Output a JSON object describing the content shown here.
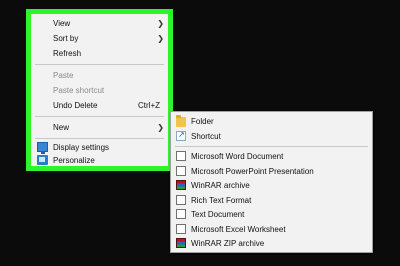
{
  "context_menu": {
    "items": [
      {
        "label": "View",
        "has_submenu": true
      },
      {
        "label": "Sort by",
        "has_submenu": true
      },
      {
        "label": "Refresh"
      },
      {
        "label": "Paste",
        "disabled": true
      },
      {
        "label": "Paste shortcut",
        "disabled": true
      },
      {
        "label": "Undo Delete",
        "shortcut": "Ctrl+Z"
      },
      {
        "label": "New",
        "has_submenu": true
      },
      {
        "label": "Display settings",
        "icon": "display-settings-icon"
      },
      {
        "label": "Personalize",
        "icon": "personalize-icon"
      }
    ]
  },
  "new_submenu": {
    "items": [
      {
        "label": "Folder",
        "icon": "folder-icon"
      },
      {
        "label": "Shortcut",
        "icon": "shortcut-icon"
      },
      {
        "label": "Microsoft Word Document",
        "icon": "document-icon"
      },
      {
        "label": "Microsoft PowerPoint Presentation",
        "icon": "document-icon"
      },
      {
        "label": "WinRAR archive",
        "icon": "winrar-icon"
      },
      {
        "label": "Rich Text Format",
        "icon": "document-icon"
      },
      {
        "label": "Text Document",
        "icon": "document-icon"
      },
      {
        "label": "Microsoft Excel Worksheet",
        "icon": "document-icon"
      },
      {
        "label": "WinRAR ZIP archive",
        "icon": "winrar-icon"
      }
    ]
  },
  "colors": {
    "highlight": "#2ef52a",
    "menu_bg": "#f2f2f2",
    "desktop_bg": "#0b0b0b"
  }
}
